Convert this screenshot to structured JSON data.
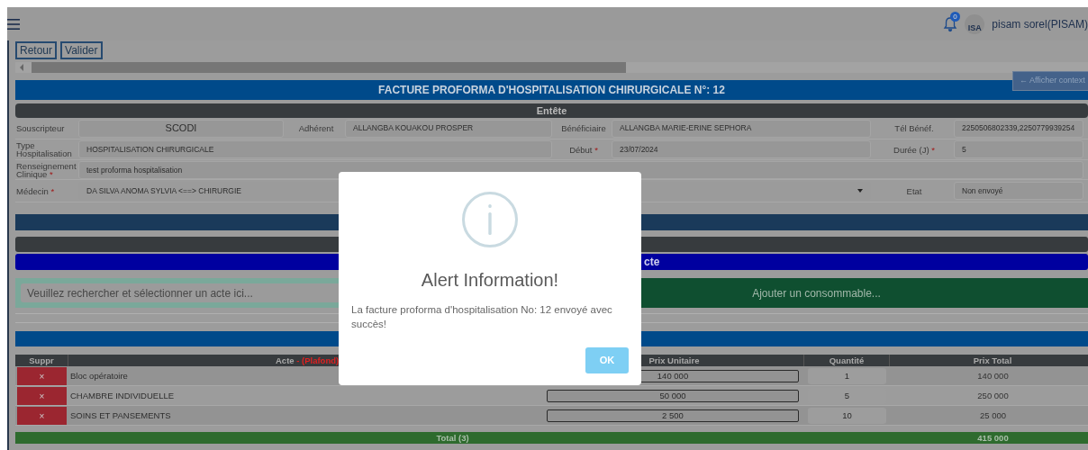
{
  "navbar": {
    "notification_count": "0",
    "logo_text": "ISA",
    "user": "pisam sorel(PISAM)"
  },
  "toolbar": {
    "buttons": [
      "Retour",
      "Valider"
    ]
  },
  "context_button": "← Afficher context",
  "title": "FACTURE PROFORMA D'HOSPITALISATION CHIRURGICALE N°: 12",
  "header_section": "Entête",
  "form_rows": [
    [
      {
        "label": "Souscripteur",
        "kind": "display",
        "value": "SCODI"
      },
      {
        "label": "Adhérent",
        "kind": "text",
        "value": "ALLANGBA KOUAKOU PROSPER"
      },
      {
        "label": "Bénéficiaire",
        "kind": "text",
        "value": "ALLANGBA MARIE-ERINE SEPHORA"
      },
      {
        "label": "Tél Bénéf.",
        "kind": "text",
        "value": "2250506802339,2250779939254"
      }
    ],
    [
      {
        "label": "Type Hospitalisation",
        "kind": "text",
        "value": "HOSPITALISATION CHIRURGICALE"
      },
      {
        "label": "Début",
        "mark": "*",
        "kind": "text",
        "value": "23/07/2024"
      },
      {
        "label": "Durée (J)",
        "mark": "*",
        "kind": "text",
        "value": "5"
      }
    ],
    [
      {
        "label": "Renseignement Clinique",
        "mark": "*",
        "kind": "text",
        "value": "test proforma hospitalisation"
      }
    ],
    [
      {
        "label": "Médecin",
        "mark": "*",
        "kind": "select",
        "value": "DA SILVA ANOMA SYLVIA <==> CHIRURGIE"
      },
      {
        "label": "Etat",
        "kind": "text",
        "value": "Non envoyé"
      }
    ]
  ],
  "acte_section_title": "cte",
  "search": {
    "placeholder": "Veuillez rechercher et sélectionner un acte ici..."
  },
  "add_consumable": "Ajouter un consommable...",
  "table": {
    "columns": [
      {
        "label": "Suppr"
      },
      {
        "label": "Acte",
        "note": "- (Plafond)"
      },
      {
        "label": "Prix Unitaire"
      },
      {
        "label": "Quantité"
      },
      {
        "label": "Prix Total"
      }
    ],
    "rows": [
      {
        "delete": "×",
        "acte": "Bloc opératoire",
        "unit_price": "140 000",
        "quantity": "1",
        "total": "140 000"
      },
      {
        "delete": "×",
        "acte": "CHAMBRE INDIVIDUELLE",
        "unit_price": "50 000",
        "quantity": "5",
        "total": "250 000"
      },
      {
        "delete": "×",
        "acte": "SOINS ET PANSEMENTS",
        "unit_price": "2 500",
        "quantity": "10",
        "total": "25 000"
      }
    ],
    "total": {
      "label": "Total (3)",
      "amount": "415 000"
    }
  },
  "modal": {
    "title": "Alert Information!",
    "message": "La facture proforma d'hospitalisation No: 12 envoyé avec succès!",
    "button": "OK"
  }
}
